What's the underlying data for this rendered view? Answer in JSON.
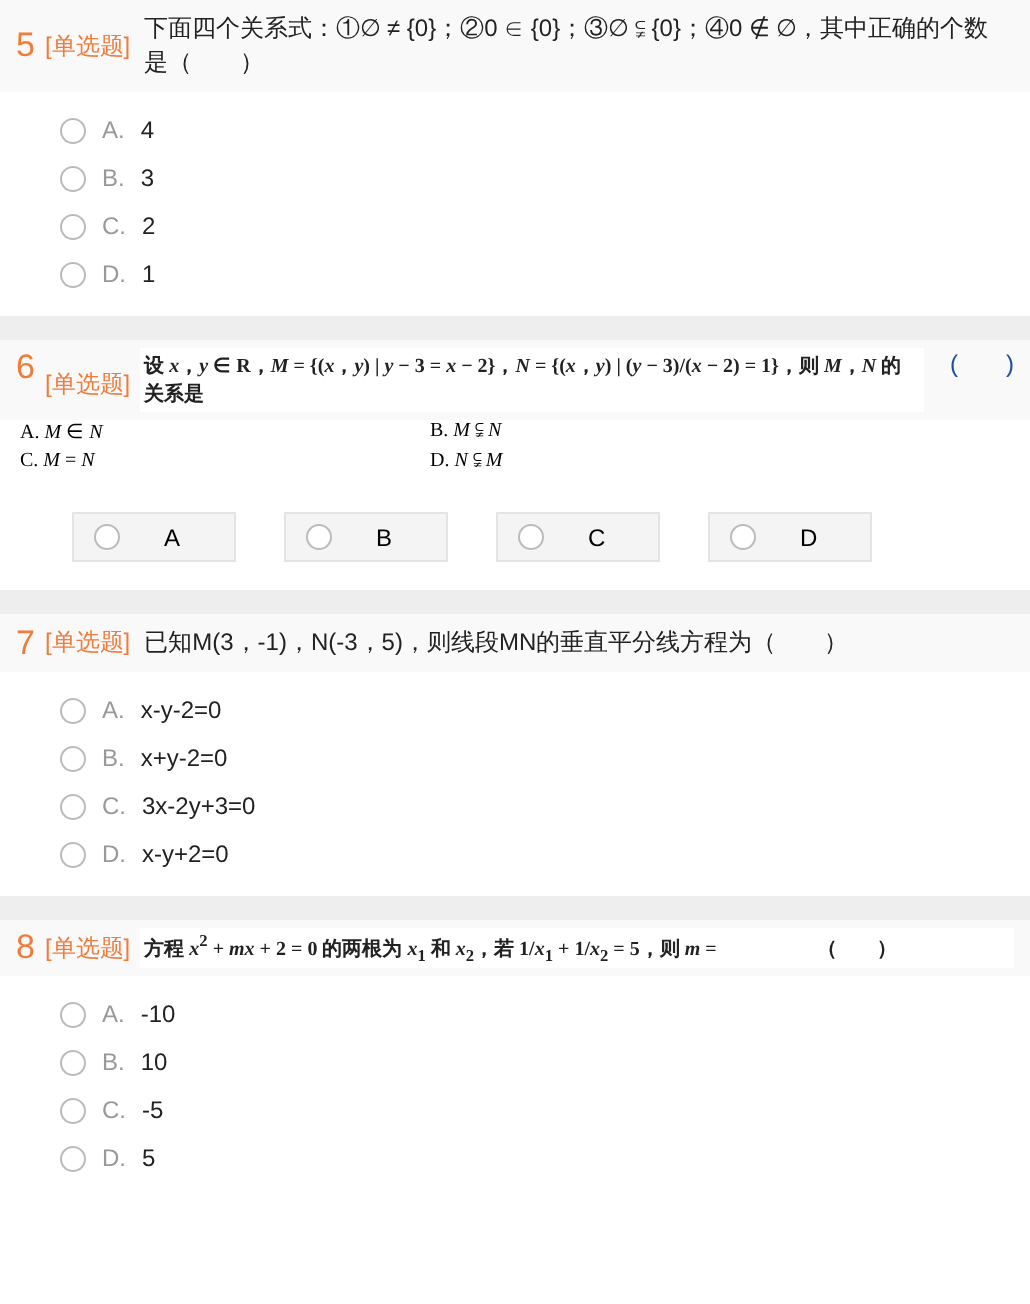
{
  "questions": [
    {
      "number": "5",
      "type": "[单选题]",
      "stem": "下面四个关系式：①∅ ≠ {0}；②0 ∈ {0}；③∅ ⫋ {0}；④0 ∉ ∅，其中正确的个数是（　　）",
      "kind": "list",
      "options": [
        {
          "letter": "A.",
          "text": "4",
          "selected": false
        },
        {
          "letter": "B.",
          "text": "3",
          "selected": false
        },
        {
          "letter": "C.",
          "text": "2",
          "selected": false
        },
        {
          "letter": "D.",
          "text": "1",
          "selected": false
        }
      ]
    },
    {
      "number": "6",
      "type": "[单选题]",
      "stem": "设 *x*，*y* ∈ **R**，*M* = {(*x*，*y*) | *y* − 3 = *x* − 2}，*N* = {(*x*，*y*) | (*y* − 3)/(*x* − 2) = 1}，则 *M*，*N* 的关系是",
      "blank": "(　　)",
      "kind": "buttons",
      "choices": [
        "A. *M* ∈ *N*",
        "B. *M* ⫋ *N*",
        "C. *M* = *N*",
        "D. *N* ⫋ *M*"
      ],
      "options": [
        {
          "text": "A",
          "selected": false
        },
        {
          "text": "B",
          "selected": false
        },
        {
          "text": "C",
          "selected": false
        },
        {
          "text": "D",
          "selected": false
        }
      ]
    },
    {
      "number": "7",
      "type": "[单选题]",
      "stem": "已知M(3，-1)，N(-3，5)，则线段MN的垂直平分线方程为（　　）",
      "kind": "list",
      "options": [
        {
          "letter": "A.",
          "text": "x-y-2=0",
          "selected": false
        },
        {
          "letter": "B.",
          "text": "x+y-2=0",
          "selected": false
        },
        {
          "letter": "C.",
          "text": "3x-2y+3=0",
          "selected": false
        },
        {
          "letter": "D.",
          "text": "x-y+2=0",
          "selected": false
        }
      ]
    },
    {
      "number": "8",
      "type": "[单选题]",
      "stem": "方程 *x*$^{2}$ + *mx* + 2 = 0 的两根为 *x*$_{1}$ 和 *x*$_{2}$，若 1/*x*$_{1}$ + 1/*x*$_{2}$ = 5，则 *m* =　　　　　（　　）",
      "kind": "list",
      "options": [
        {
          "letter": "A.",
          "text": "-10",
          "selected": false
        },
        {
          "letter": "B.",
          "text": "10",
          "selected": false
        },
        {
          "letter": "C.",
          "text": "-5",
          "selected": false
        },
        {
          "letter": "D.",
          "text": "5",
          "selected": false
        }
      ]
    }
  ]
}
